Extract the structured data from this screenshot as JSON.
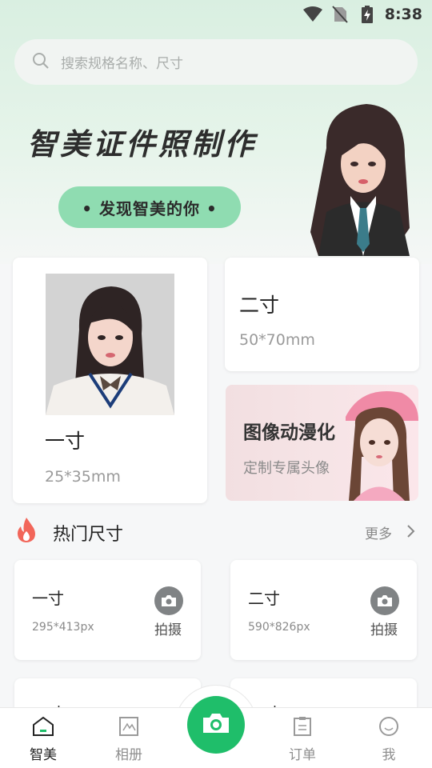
{
  "status_bar": {
    "time": "8:38"
  },
  "search": {
    "placeholder": "搜索规格名称、尺寸"
  },
  "banner": {
    "title": "智美证件照制作",
    "pill": "• 发现智美的你 •"
  },
  "cards": {
    "one_inch": {
      "title": "一寸",
      "size": "25*35mm"
    },
    "two_inch": {
      "title": "二寸",
      "size": "50*70mm"
    },
    "anime": {
      "title": "图像动漫化",
      "subtitle": "定制专属头像"
    }
  },
  "hot": {
    "title": "热门尺寸",
    "more": "更多",
    "items": [
      {
        "name": "一寸",
        "px": "295*413px",
        "action": "拍摄"
      },
      {
        "name": "二寸",
        "px": "590*826px",
        "action": "拍摄"
      },
      {
        "name": "三寸",
        "px": "",
        "action": ""
      },
      {
        "name": "五寸",
        "px": "",
        "action": ""
      }
    ]
  },
  "nav": {
    "items": [
      {
        "label": "智美",
        "icon": "home-icon",
        "active": true
      },
      {
        "label": "相册",
        "icon": "album-icon",
        "active": false
      },
      {
        "label": "订单",
        "icon": "order-icon",
        "active": false
      },
      {
        "label": "我",
        "icon": "profile-icon",
        "active": false
      }
    ],
    "center_icon": "camera-icon"
  },
  "colors": {
    "accent": "#1fbe6a",
    "pill": "#8fdcb1",
    "hot_flame": "#f2665a"
  }
}
